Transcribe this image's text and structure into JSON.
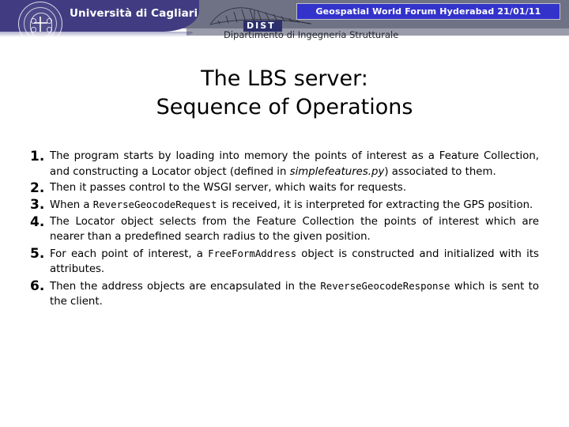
{
  "header": {
    "university": "Università di Cagliari",
    "dist_abbrev": "DIST",
    "dist_department": "Dipartimento di Ingegneria Strutturale",
    "conference_banner": "Geospatial World Forum Hyderabad 21/01/11",
    "colors": {
      "purple": "#413c82",
      "banner_blue": "#3333cc",
      "gray_band": "#6f7285",
      "dist_box": "#2c2f6b"
    }
  },
  "slide": {
    "title_line1": "The LBS server:",
    "title_line2": "Sequence of Operations",
    "items": [
      {
        "number": "1.",
        "parts": [
          {
            "type": "text",
            "value": "The program starts by loading into memory the points of interest as a Feature Collection, and constructing a Locator object (defined in "
          },
          {
            "type": "italic",
            "value": "simplefeatures.py"
          },
          {
            "type": "text",
            "value": ") associated to them."
          }
        ]
      },
      {
        "number": "2.",
        "parts": [
          {
            "type": "text",
            "value": "Then it passes control to the WSGI server, which waits for requests."
          }
        ]
      },
      {
        "number": "3.",
        "parts": [
          {
            "type": "text",
            "value": "When a "
          },
          {
            "type": "mono",
            "value": "ReverseGeocodeRequest"
          },
          {
            "type": "text",
            "value": " is received, it is interpreted for extracting the GPS position."
          }
        ]
      },
      {
        "number": "4.",
        "parts": [
          {
            "type": "text",
            "value": "The Locator object selects from the Feature Collection the points of interest which are nearer than a predefined search radius to the given position."
          }
        ]
      },
      {
        "number": "5.",
        "parts": [
          {
            "type": "text",
            "value": "For each point of interest, a  "
          },
          {
            "type": "mono",
            "value": "FreeFormAddress"
          },
          {
            "type": "text",
            "value": " object is constructed and initialized with its attributes."
          }
        ]
      },
      {
        "number": "6.",
        "parts": [
          {
            "type": "text",
            "value": "Then the address objects are encapsulated in the "
          },
          {
            "type": "mono",
            "value": "ReverseGeocodeResponse"
          },
          {
            "type": "text",
            "value": " which is sent to the client."
          }
        ]
      }
    ]
  }
}
